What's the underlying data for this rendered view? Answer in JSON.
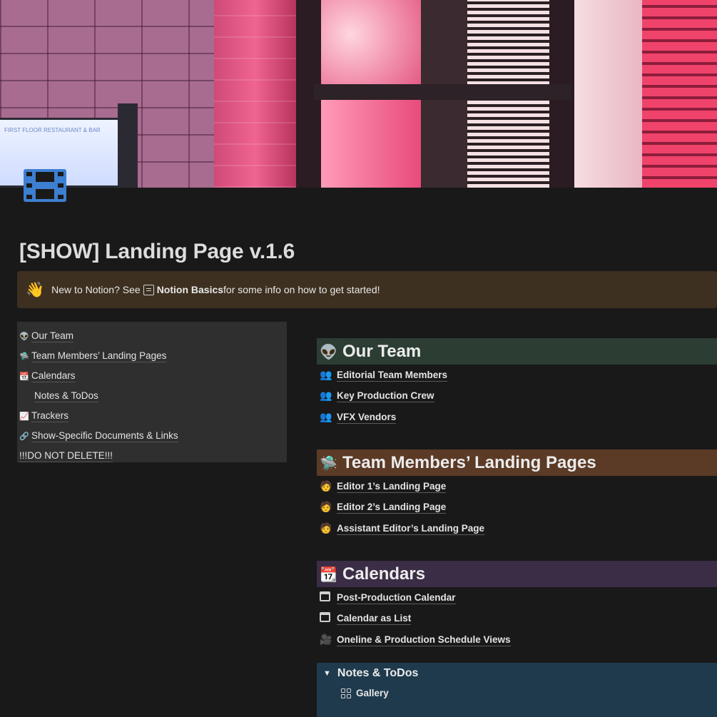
{
  "page": {
    "title": "[SHOW] Landing Page v.1.6"
  },
  "cover": {
    "monitor_text": "FIRST FLOOR RESTAURANT & BAR"
  },
  "callout": {
    "emoji": "👋",
    "prefix": "New to Notion? See ",
    "link": "Notion Basics",
    "suffix": " for some info on how to get started!"
  },
  "toc": {
    "items": [
      {
        "icon": "👽",
        "label": "Our Team"
      },
      {
        "icon": "🛸",
        "label": "Team Members’ Landing Pages"
      },
      {
        "icon": "📆",
        "label": "Calendars"
      },
      {
        "icon": "",
        "label": "Notes & ToDos"
      },
      {
        "icon": "📈",
        "label": "Trackers"
      },
      {
        "icon": "🔗",
        "label": "Show-Specific Documents & Links"
      },
      {
        "icon": "",
        "label": "!!!DO NOT DELETE!!!"
      }
    ]
  },
  "sections": {
    "team": {
      "title": "Our Team",
      "icon": "👽",
      "color": "#2c3e33",
      "links": [
        {
          "icon": "👥",
          "label": "Editorial Team Members"
        },
        {
          "icon": "👥",
          "label": "Key Production Crew"
        },
        {
          "icon": "👥",
          "label": "VFX Vendors"
        }
      ]
    },
    "landing": {
      "title": "Team Members’ Landing Pages",
      "icon": "🛸",
      "color": "#5b3a26",
      "links": [
        {
          "icon": "🧑",
          "label": "Editor 1’s Landing Page"
        },
        {
          "icon": "🧑",
          "label": "Editor 2’s Landing Page"
        },
        {
          "icon": "🧑",
          "label": "Assistant Editor’s Landing Page"
        }
      ]
    },
    "calendars": {
      "title": "Calendars",
      "icon": "📆",
      "color": "#3b2d45",
      "links": [
        {
          "icon": "calendar-icon",
          "label": "Post-Production Calendar"
        },
        {
          "icon": "calendar-icon",
          "label": "Calendar as List"
        },
        {
          "icon": "🎥",
          "label": "Oneline & Production Schedule Views"
        }
      ]
    },
    "notes": {
      "title": "Notes & ToDos",
      "color": "#1f3a4d",
      "gallery_label": "Gallery"
    }
  }
}
